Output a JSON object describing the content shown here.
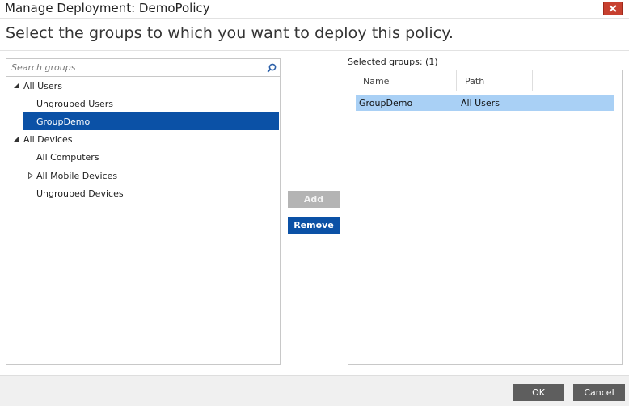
{
  "window": {
    "title": "Manage Deployment: DemoPolicy",
    "close_icon": "close-icon"
  },
  "heading": "Select the groups to which you want to deploy this policy.",
  "search": {
    "placeholder": "Search groups",
    "value": "",
    "icon": "search-icon"
  },
  "tree": {
    "items": [
      {
        "label": "All Users",
        "expanded": true,
        "has_children": true
      },
      {
        "label": "Ungrouped Users"
      },
      {
        "label": "GroupDemo",
        "selected": true
      },
      {
        "label": "All Devices",
        "expanded": true,
        "has_children": true
      },
      {
        "label": "All Computers"
      },
      {
        "label": "All Mobile Devices",
        "expanded": false,
        "has_children": true
      },
      {
        "label": "Ungrouped Devices"
      }
    ]
  },
  "actions": {
    "add_label": "Add",
    "add_enabled": false,
    "remove_label": "Remove",
    "remove_enabled": true
  },
  "selected_groups": {
    "label": "Selected groups: (1)",
    "columns": [
      "Name",
      "Path"
    ],
    "rows": [
      {
        "name": "GroupDemo",
        "path": "All Users",
        "selected": true
      }
    ]
  },
  "footer": {
    "ok_label": "OK",
    "cancel_label": "Cancel"
  },
  "colors": {
    "accent": "#0b51a6",
    "selection_light": "#a9d0f5",
    "close_red": "#c7402f",
    "footer_button": "#5e5e5e",
    "disabled_button": "#b4b4b4"
  }
}
